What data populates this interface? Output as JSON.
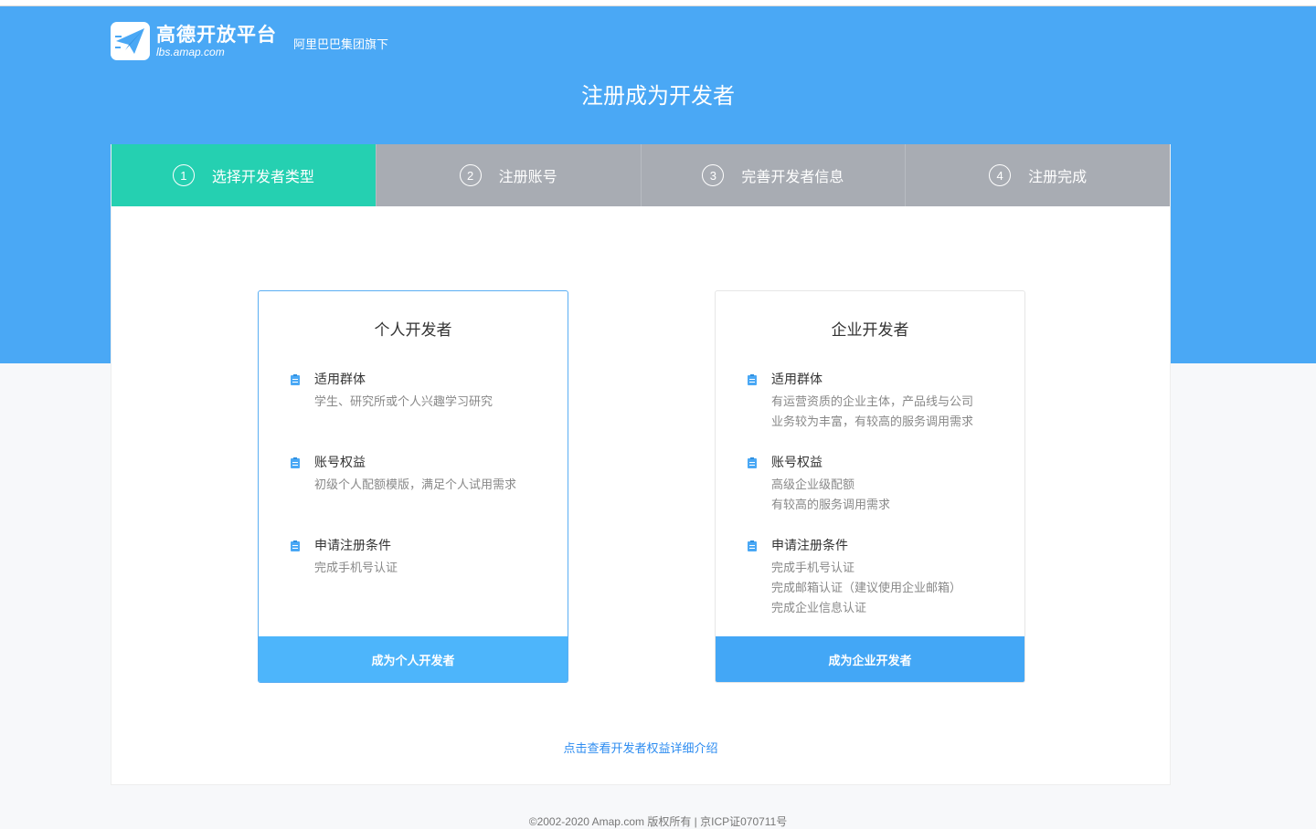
{
  "header": {
    "logo_name": "高德开放平台",
    "logo_url": "lbs.amap.com",
    "logo_tag": "阿里巴巴集团旗下",
    "page_title": "注册成为开发者"
  },
  "steps": [
    {
      "num": "1",
      "label": "选择开发者类型",
      "active": true
    },
    {
      "num": "2",
      "label": "注册账号",
      "active": false
    },
    {
      "num": "3",
      "label": "完善开发者信息",
      "active": false
    },
    {
      "num": "4",
      "label": "注册完成",
      "active": false
    }
  ],
  "personal": {
    "title": "个人开发者",
    "sections": [
      {
        "head": "适用群体",
        "lines": [
          "学生、研究所或个人兴趣学习研究"
        ]
      },
      {
        "head": "账号权益",
        "lines": [
          "初级个人配额模版，满足个人试用需求"
        ]
      },
      {
        "head": "申请注册条件",
        "lines": [
          "完成手机号认证"
        ]
      }
    ],
    "button": "成为个人开发者"
  },
  "enterprise": {
    "title": "企业开发者",
    "sections": [
      {
        "head": "适用群体",
        "lines": [
          "有运营资质的企业主体，产品线与公司",
          "业务较为丰富，有较高的服务调用需求"
        ]
      },
      {
        "head": "账号权益",
        "lines": [
          "高级企业级配额",
          "有较高的服务调用需求"
        ]
      },
      {
        "head": "申请注册条件",
        "lines": [
          "完成手机号认证",
          "完成邮箱认证（建议使用企业邮箱）",
          "完成企业信息认证"
        ]
      }
    ],
    "button": "成为企业开发者"
  },
  "more_link": "点击查看开发者权益详细介绍",
  "footer": "©2002-2020 Amap.com 版权所有 | 京ICP证070711号",
  "colors": {
    "hero": "#4aa8f5",
    "step_active": "#25d0b1",
    "step_inactive": "#a8acb3",
    "link": "#2d8cf0"
  }
}
